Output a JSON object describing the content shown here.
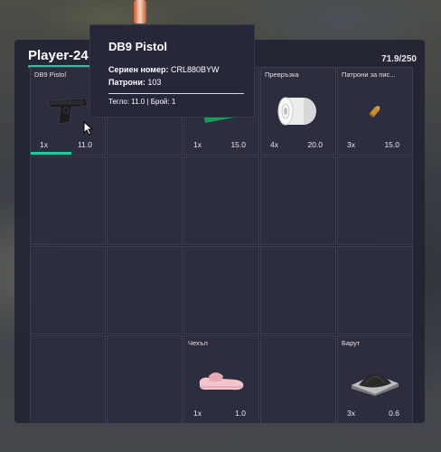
{
  "player": {
    "name": "Player-24",
    "weight": "71.9/250"
  },
  "tooltip": {
    "title": "DB9 Pistol",
    "serial_label": "Сериен номер:",
    "serial_value": "CRL880BYW",
    "ammo_label": "Патрони:",
    "ammo_value": "103",
    "footer": "Тегло: 11.0 | Брой: 1"
  },
  "slots": [
    {
      "label": "DB9 Pistol",
      "count": "1x",
      "weight": "11.0",
      "icon": "pistol-icon",
      "durability": 0.55
    },
    {
      "label": "",
      "count": "",
      "weight": "",
      "icon": ""
    },
    {
      "label": "",
      "count": "1x",
      "weight": "15.0",
      "icon": "first-aid-kit-icon"
    },
    {
      "label": "Превръзка",
      "count": "4x",
      "weight": "20.0",
      "icon": "bandage-icon"
    },
    {
      "label": "Патрони за пис...",
      "count": "3x",
      "weight": "15.0",
      "icon": "pistol-ammo-icon"
    },
    {
      "label": "",
      "count": "",
      "weight": "",
      "icon": ""
    },
    {
      "label": "",
      "count": "",
      "weight": "",
      "icon": ""
    },
    {
      "label": "",
      "count": "",
      "weight": "",
      "icon": ""
    },
    {
      "label": "",
      "count": "",
      "weight": "",
      "icon": ""
    },
    {
      "label": "",
      "count": "",
      "weight": "",
      "icon": ""
    },
    {
      "label": "",
      "count": "",
      "weight": "",
      "icon": ""
    },
    {
      "label": "",
      "count": "",
      "weight": "",
      "icon": ""
    },
    {
      "label": "",
      "count": "",
      "weight": "",
      "icon": ""
    },
    {
      "label": "",
      "count": "",
      "weight": "",
      "icon": ""
    },
    {
      "label": "",
      "count": "",
      "weight": "",
      "icon": ""
    },
    {
      "label": "",
      "count": "",
      "weight": "",
      "icon": ""
    },
    {
      "label": "",
      "count": "",
      "weight": "",
      "icon": ""
    },
    {
      "label": "Чехъл",
      "count": "1x",
      "weight": "1.0",
      "icon": "slipper-icon"
    },
    {
      "label": "",
      "count": "",
      "weight": "",
      "icon": ""
    },
    {
      "label": "Барут",
      "count": "3x",
      "weight": "0.6",
      "icon": "gunpowder-icon"
    }
  ],
  "colors": {
    "accent": "#22c79e",
    "panel": "#222432",
    "slot": "#2e3040"
  }
}
